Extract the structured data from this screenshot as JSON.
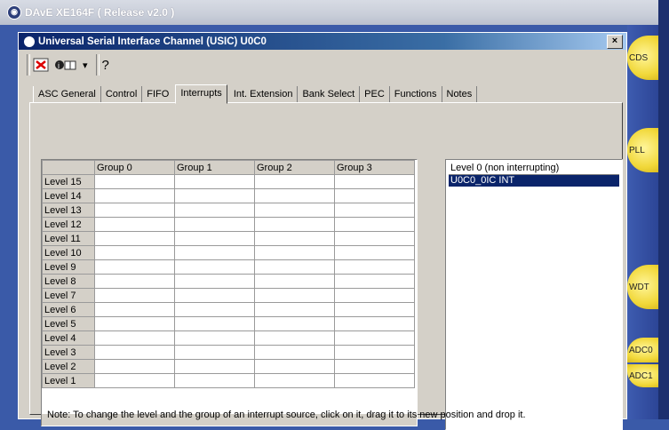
{
  "app": {
    "title": "DAvE XE164F ( Release v2.0 )"
  },
  "dialog": {
    "title": "Universal Serial Interface Channel (USIC) U0C0",
    "close_label": "×"
  },
  "toolbar": {
    "icons": [
      "undo-icon",
      "help-book-icon",
      "dropdown-arrow-icon",
      "question-icon"
    ],
    "dropdown_glyph": "▾",
    "question_glyph": "?"
  },
  "tabs": [
    {
      "label": "ASC General"
    },
    {
      "label": "Control"
    },
    {
      "label": "FIFO"
    },
    {
      "label": "Interrupts",
      "active": true
    },
    {
      "label": "Int. Extension"
    },
    {
      "label": "Bank Select"
    },
    {
      "label": "PEC"
    },
    {
      "label": "Functions"
    },
    {
      "label": "Notes"
    }
  ],
  "grid": {
    "columns": [
      "",
      "Group 0",
      "Group 1",
      "Group 2",
      "Group 3"
    ],
    "rows": [
      "Level 15",
      "Level 14",
      "Level 13",
      "Level 12",
      "Level 11",
      "Level 10",
      "Level 9",
      "Level 8",
      "Level 7",
      "Level 6",
      "Level 5",
      "Level 4",
      "Level 3",
      "Level 2",
      "Level 1"
    ]
  },
  "level0_list": {
    "header": "Level 0 (non interrupting)",
    "items": [
      "U0C0_0IC INT"
    ]
  },
  "note": "Note: To change the level and the group of an interrupt source, click on it, drag it to its new position and drop it.",
  "modules": [
    "CDS",
    "PLL",
    "WDT",
    "ADC0",
    "ADC1"
  ],
  "colors": {
    "selection": "#0a246a",
    "module_button": "#f1d83a",
    "dialog_face": "#d4d0c8"
  }
}
